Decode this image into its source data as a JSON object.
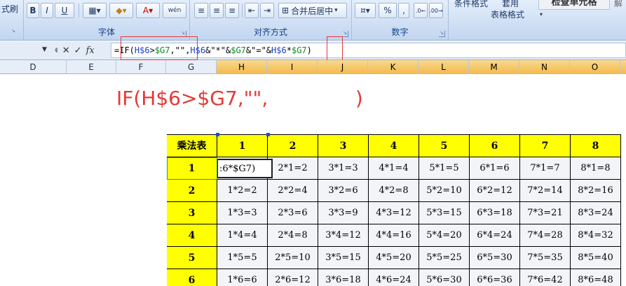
{
  "ribbon": {
    "format_painter": "式刷",
    "font_group": "字体",
    "align_group": "对齐方式",
    "number_group": "数字",
    "bold": "B",
    "italic": "I",
    "underline": "U",
    "wen": "wén",
    "merge_center": "合并后居中",
    "percent": "%",
    "comma": ",",
    "cond_format": "条件格式",
    "cell_style_title": "套用",
    "table_format": "表格格式",
    "check_cell": "检查单元格",
    "cut_off": "解"
  },
  "formula_bar": {
    "fx": "fx",
    "formula": "=IF(H$6>$G7,\"\",H$6&\"*\"&$G7&\"=\"&H$6*$G7)",
    "parts": {
      "p1": "=IF(",
      "p2": "H$6",
      "p3": ">",
      "p4": "$G7",
      "p5": ",\"\",",
      "p6": "H$6",
      "p7": "&\"*\"&",
      "p8": "$G7",
      "p9": "&\"=\"&",
      "p10": "H$6",
      "p11": "*",
      "p12": "$G7",
      "p13": ")"
    }
  },
  "columns": [
    "D",
    "E",
    "F",
    "G",
    "H",
    "I",
    "J",
    "K",
    "L",
    "M",
    "N",
    "O"
  ],
  "annotation": "IF(H$6>$G7,\"\",              )",
  "table": {
    "corner": "乘法表",
    "col_headers": [
      "1",
      "2",
      "3",
      "4",
      "5",
      "6",
      "7",
      "8"
    ],
    "row_headers": [
      "1",
      "2",
      "3",
      "4",
      "5",
      "6"
    ],
    "active_cell_text": ":6*$G7)",
    "rows": [
      [
        "",
        "2*1=2",
        "3*1=3",
        "4*1=4",
        "5*1=5",
        "6*1=6",
        "7*1=7",
        "8*1=8"
      ],
      [
        "1*2=2",
        "2*2=4",
        "3*2=6",
        "4*2=8",
        "5*2=10",
        "6*2=12",
        "7*2=14",
        "8*2=16"
      ],
      [
        "1*3=3",
        "2*3=6",
        "3*3=9",
        "4*3=12",
        "5*3=15",
        "6*3=18",
        "7*3=21",
        "8*3=24"
      ],
      [
        "1*4=4",
        "2*4=8",
        "3*4=12",
        "4*4=16",
        "5*4=20",
        "6*4=24",
        "7*4=28",
        "8*4=32"
      ],
      [
        "1*5=5",
        "2*5=10",
        "3*5=15",
        "4*5=20",
        "5*5=25",
        "6*5=30",
        "7*5=35",
        "8*5=40"
      ],
      [
        "1*6=6",
        "2*6=12",
        "3*6=18",
        "4*6=24",
        "5*6=30",
        "6*6=36",
        "7*6=42",
        "8*6=48"
      ]
    ]
  },
  "colors": {
    "header_yellow": "#ffff00",
    "annotation_red": "#e53935",
    "ref_blue": "#1a3fcf",
    "ref_green": "#0a8a1f"
  }
}
